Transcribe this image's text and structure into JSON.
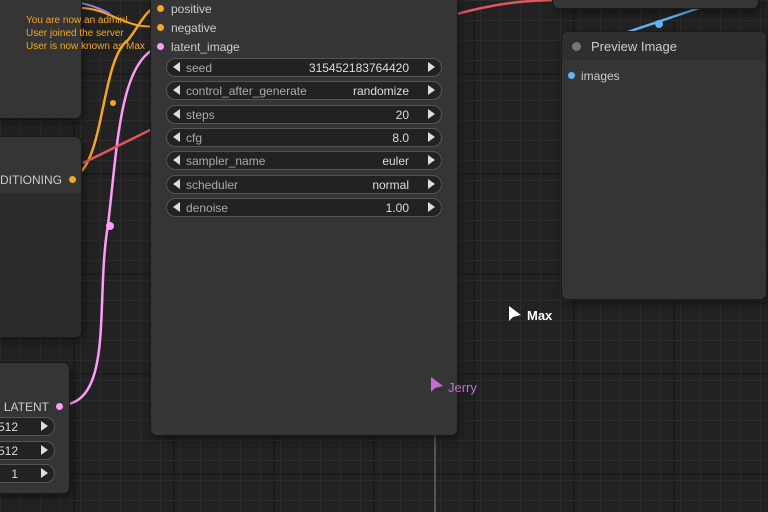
{
  "chat": {
    "messages": [
      "You are now an admin!",
      "User joined the server",
      "User is now known as Max"
    ]
  },
  "conditioning_node": {
    "output_label": "DITIONING"
  },
  "latent_node": {
    "output_label": "LATENT",
    "widgets": [
      "512",
      "512",
      "1"
    ]
  },
  "ksampler_node": {
    "inputs": [
      "positive",
      "negative",
      "latent_image"
    ],
    "widgets": [
      {
        "label": "seed",
        "value": "315452183764420"
      },
      {
        "label": "control_after_generate",
        "value": "randomize"
      },
      {
        "label": "steps",
        "value": "20"
      },
      {
        "label": "cfg",
        "value": "8.0"
      },
      {
        "label": "sampler_name",
        "value": "euler"
      },
      {
        "label": "scheduler",
        "value": "normal"
      },
      {
        "label": "denoise",
        "value": "1.00"
      }
    ]
  },
  "preview_node": {
    "title": "Preview Image",
    "input_label": "images"
  },
  "cursors": [
    {
      "name": "Max",
      "color": "#ffffff"
    },
    {
      "name": "Jerry",
      "color": "#c86ad8"
    }
  ],
  "colors": {
    "conditioning": "#f5a623",
    "latent": "#ff9cf9",
    "image": "#64b5f6",
    "model": "#e0565b"
  }
}
